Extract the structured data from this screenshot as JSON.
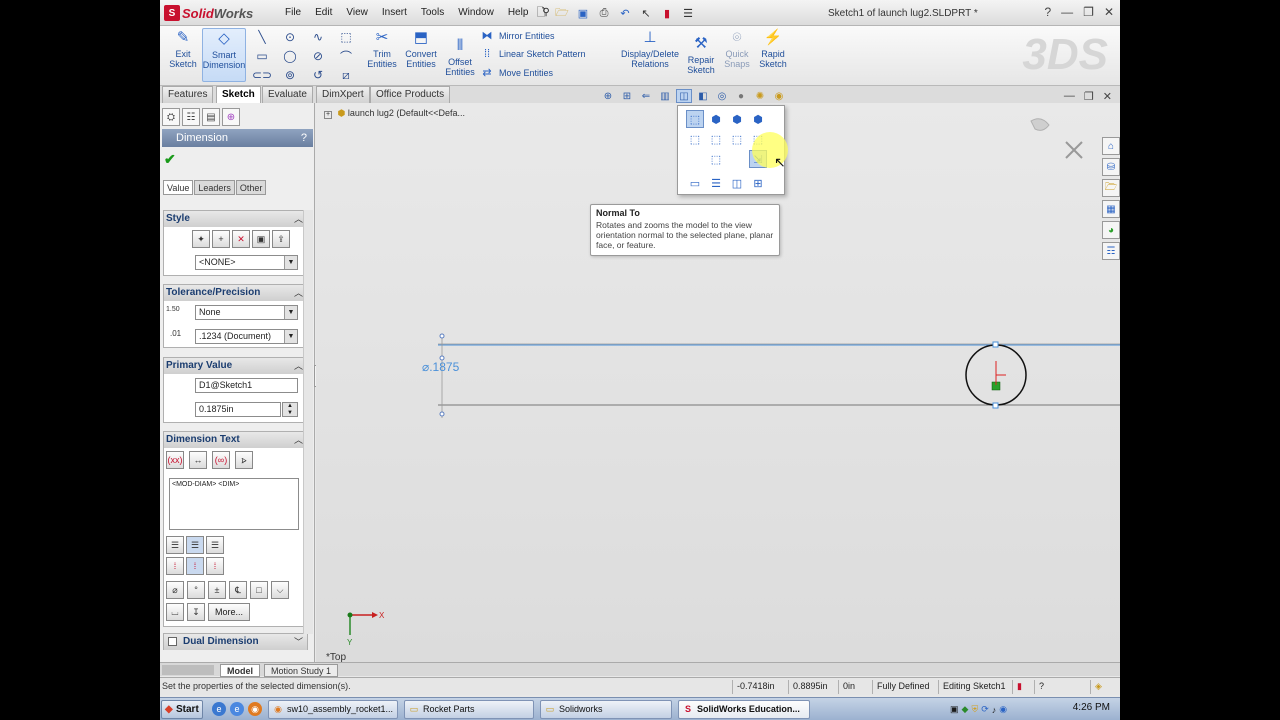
{
  "app": {
    "logo_solid": "Solid",
    "logo_works": "Works",
    "window_title": "Sketch1 of launch lug2.SLDPRT *",
    "menu": [
      "File",
      "Edit",
      "View",
      "Insert",
      "Tools",
      "Window",
      "Help"
    ]
  },
  "commands": {
    "exit_sketch": "Exit Sketch",
    "smart_dimension": "Smart Dimension",
    "trim_entities": "Trim Entities",
    "convert_entities": "Convert Entities",
    "offset_entities": "Offset Entities",
    "mirror_entities": "Mirror Entities",
    "linear_sketch_pattern": "Linear Sketch Pattern",
    "move_entities": "Move Entities",
    "display_delete_relations": "Display/Delete Relations",
    "repair_sketch": "Repair Sketch",
    "quick_snaps": "Quick Snaps",
    "rapid_sketch": "Rapid Sketch"
  },
  "tabs": [
    "Features",
    "Sketch",
    "Evaluate",
    "DimXpert",
    "Office Products"
  ],
  "active_tab": "Sketch",
  "property_manager": {
    "title": "Dimension",
    "help": "?",
    "subtabs": [
      "Value",
      "Leaders",
      "Other"
    ],
    "style": {
      "header": "Style",
      "value": "<NONE>"
    },
    "tolerance": {
      "header": "Tolerance/Precision",
      "tol_icon": "1.50",
      "tolerance_type": "None",
      "precision": ".1234 (Document)"
    },
    "primary_value": {
      "header": "Primary Value",
      "name": "D1@Sketch1",
      "value": "0.1875in"
    },
    "dimension_text": {
      "header": "Dimension Text",
      "text": "<MOD-DIAM> <DIM>",
      "more_button": "More..."
    },
    "dual_dimension": "Dual Dimension"
  },
  "graphics": {
    "tree_item": "launch lug2  (Default<<Defa...",
    "dimension_label": "⌀.1875",
    "view_label": "*Top",
    "axis_x": "X",
    "axis_y": "Y"
  },
  "tooltip": {
    "title": "Normal To",
    "body": "Rotates and zooms the model to the view orientation normal to the selected plane, planar face, or feature."
  },
  "bottom_tabs": [
    "Model",
    "Motion Study 1"
  ],
  "status": {
    "message": "Set the properties of the selected dimension(s).",
    "x": "-0.7418in",
    "y": "0.8895in",
    "z": "0in",
    "state": "Fully Defined",
    "editing": "Editing Sketch1"
  },
  "taskbar": {
    "start": "Start",
    "items": [
      "sw10_assembly_rocket1...",
      "Rocket Parts",
      "Solidworks",
      "SolidWorks Education..."
    ],
    "time": "4:26 PM"
  },
  "colors": {
    "accent": "#2a63c4",
    "sketch_blue": "#4a90d9",
    "highlight": "#ffff5a"
  }
}
